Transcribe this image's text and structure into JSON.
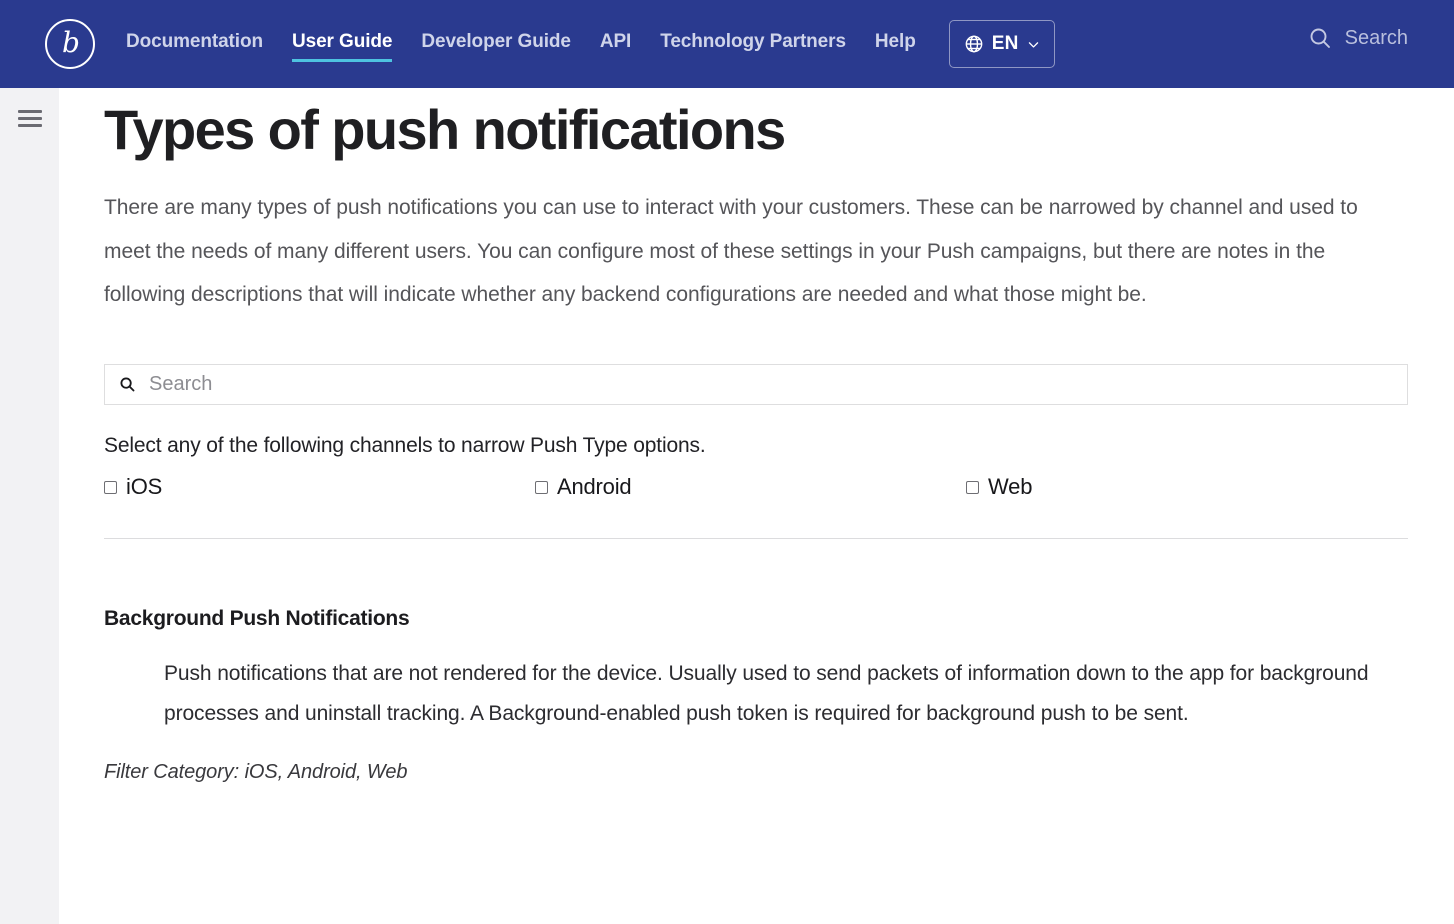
{
  "colors": {
    "nav_background": "#2a3a8f",
    "nav_active_underline": "#4ec3e0",
    "rail_background": "#f2f2f4",
    "page_background": "#ffffff",
    "body_text": "#555559",
    "divider": "#dcdcde"
  },
  "topnav": {
    "logo_glyph": "b",
    "logo_name": "braze-logo",
    "links": [
      {
        "label": "Documentation",
        "active": false
      },
      {
        "label": "User Guide",
        "active": true
      },
      {
        "label": "Developer Guide",
        "active": false
      },
      {
        "label": "API",
        "active": false
      },
      {
        "label": "Technology Partners",
        "active": false
      },
      {
        "label": "Help",
        "active": false
      }
    ],
    "language": {
      "label": "EN",
      "globe_icon": "globe-icon",
      "chevron_icon": "chevron-down-icon"
    },
    "search": {
      "icon": "search-icon",
      "label": "Search"
    }
  },
  "rail": {
    "menu_icon": "hamburger-menu-icon"
  },
  "main": {
    "title": "Types of push notifications",
    "intro": "There are many types of push notifications you can use to interact with your customers. These can be narrowed by channel and used to meet the needs of many different users. You can configure most of these settings in your Push campaigns, but there are notes in the following descriptions that will indicate whether any backend configurations are needed and what those might be.",
    "search": {
      "icon": "search-icon",
      "placeholder": "Search",
      "value": ""
    },
    "channel_prompt": "Select any of the following channels to narrow Push Type options.",
    "channels": [
      {
        "label": "iOS",
        "checked": false
      },
      {
        "label": "Android",
        "checked": false
      },
      {
        "label": "Web",
        "checked": false
      }
    ],
    "entries": [
      {
        "title": "Background Push Notifications",
        "body": "Push notifications that are not rendered for the device. Usually used to send packets of information down to the app for background processes and uninstall tracking. A Background-enabled push token is required for background push to be sent.",
        "filter_category": "Filter Category: iOS, Android, Web"
      }
    ]
  }
}
